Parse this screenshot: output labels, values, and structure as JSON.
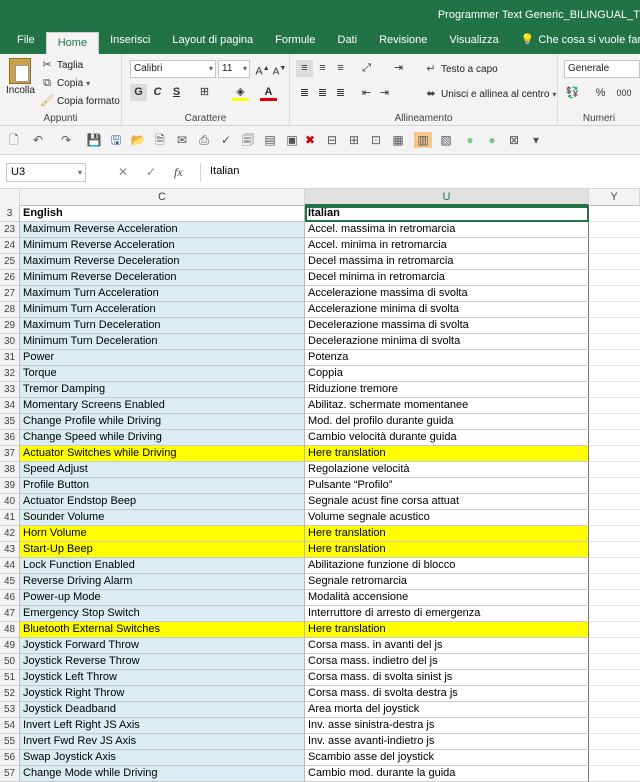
{
  "window": {
    "title": "Programmer Text Generic_BILINGUAL_T"
  },
  "tabs": [
    "File",
    "Home",
    "Inserisci",
    "Layout di pagina",
    "Formule",
    "Dati",
    "Revisione",
    "Visualizza"
  ],
  "tell_me": "Che cosa si vuole fare?",
  "ribbon": {
    "clipboard": {
      "paste": "Incolla",
      "cut": "Taglia",
      "copy": "Copia",
      "format_painter": "Copia formato",
      "label": "Appunti"
    },
    "font": {
      "name": "Calibri",
      "size": "11",
      "bold": "G",
      "italic": "C",
      "underline": "S",
      "label": "Carattere"
    },
    "alignment": {
      "wrap": "Testo a capo",
      "merge": "Unisci e allinea al centro",
      "label": "Allineamento"
    },
    "number": {
      "format": "Generale",
      "label": "Numeri",
      "percent": "%",
      "thousands": "000"
    }
  },
  "formula_bar": {
    "name_box": "U3",
    "fx": "fx",
    "content": "Italian"
  },
  "columns": {
    "c": "C",
    "u": "U",
    "y": "Y"
  },
  "rows": [
    {
      "n": "3",
      "en": "English",
      "it": "Italian",
      "type": "hdr"
    },
    {
      "n": "23",
      "en": "Maximum Reverse Acceleration",
      "it": "Accel. massima in retromarcia"
    },
    {
      "n": "24",
      "en": "Minimum Reverse Acceleration",
      "it": "Accel. minima in retromarcia"
    },
    {
      "n": "25",
      "en": "Maximum Reverse Deceleration",
      "it": "Decel massima in retromarcia"
    },
    {
      "n": "26",
      "en": "Minimum Reverse Deceleration",
      "it": "Decel minima in retromarcia"
    },
    {
      "n": "27",
      "en": "Maximum Turn Acceleration",
      "it": "Accelerazione massima di svolta"
    },
    {
      "n": "28",
      "en": "Minimum Turn Acceleration",
      "it": "Accelerazione minima di svolta"
    },
    {
      "n": "29",
      "en": "Maximum Turn Deceleration",
      "it": "Decelerazione massima di svolta"
    },
    {
      "n": "30",
      "en": "Minimum Turn Deceleration",
      "it": "Decelerazione minima di svolta"
    },
    {
      "n": "31",
      "en": "Power",
      "it": "Potenza"
    },
    {
      "n": "32",
      "en": "Torque",
      "it": "Coppia"
    },
    {
      "n": "33",
      "en": "Tremor Damping",
      "it": "Riduzione tremore"
    },
    {
      "n": "34",
      "en": "Momentary Screens Enabled",
      "it": "Abilitaz. schermate momentanee"
    },
    {
      "n": "35",
      "en": "Change Profile while Driving",
      "it": "Mod. del profilo durante guida"
    },
    {
      "n": "36",
      "en": "Change Speed while Driving",
      "it": "Cambio velocità durante guida"
    },
    {
      "n": "37",
      "en": "Actuator Switches while Driving",
      "it": "Here translation",
      "type": "hl"
    },
    {
      "n": "38",
      "en": "Speed Adjust",
      "it": "Regolazione velocità"
    },
    {
      "n": "39",
      "en": "Profile Button",
      "it": "Pulsante “Profilo”"
    },
    {
      "n": "40",
      "en": "Actuator Endstop Beep",
      "it": "Segnale acust fine corsa attuat"
    },
    {
      "n": "41",
      "en": "Sounder Volume",
      "it": "Volume segnale acustico"
    },
    {
      "n": "42",
      "en": "Horn Volume",
      "it": "Here translation",
      "type": "hl"
    },
    {
      "n": "43",
      "en": "Start-Up Beep",
      "it": "Here translation",
      "type": "hl"
    },
    {
      "n": "44",
      "en": "Lock Function Enabled",
      "it": "Abilitazione funzione di blocco"
    },
    {
      "n": "45",
      "en": "Reverse Driving Alarm",
      "it": "Segnale retromarcia"
    },
    {
      "n": "46",
      "en": "Power-up Mode",
      "it": "Modalità accensione"
    },
    {
      "n": "47",
      "en": "Emergency Stop Switch",
      "it": "Interruttore di arresto di emergenza"
    },
    {
      "n": "48",
      "en": "Bluetooth External Switches",
      "it": "Here translation",
      "type": "hl"
    },
    {
      "n": "49",
      "en": "Joystick Forward Throw",
      "it": "Corsa mass. in avanti del js"
    },
    {
      "n": "50",
      "en": "Joystick Reverse Throw",
      "it": "Corsa mass. indietro del js"
    },
    {
      "n": "51",
      "en": "Joystick Left Throw",
      "it": "Corsa mass. di svolta sinist js"
    },
    {
      "n": "52",
      "en": "Joystick Right Throw",
      "it": "Corsa mass. di svolta destra js"
    },
    {
      "n": "53",
      "en": "Joystick Deadband",
      "it": "Area morta del joystick"
    },
    {
      "n": "54",
      "en": "Invert Left Right JS Axis",
      "it": "Inv. asse sinistra-destra js"
    },
    {
      "n": "55",
      "en": "Invert Fwd Rev JS Axis",
      "it": "Inv. asse avanti-indietro js"
    },
    {
      "n": "56",
      "en": "Swap Joystick Axis",
      "it": "Scambio asse del joystick"
    },
    {
      "n": "57",
      "en": "Change Mode while Driving",
      "it": "Cambio mod. durante la guida"
    }
  ]
}
